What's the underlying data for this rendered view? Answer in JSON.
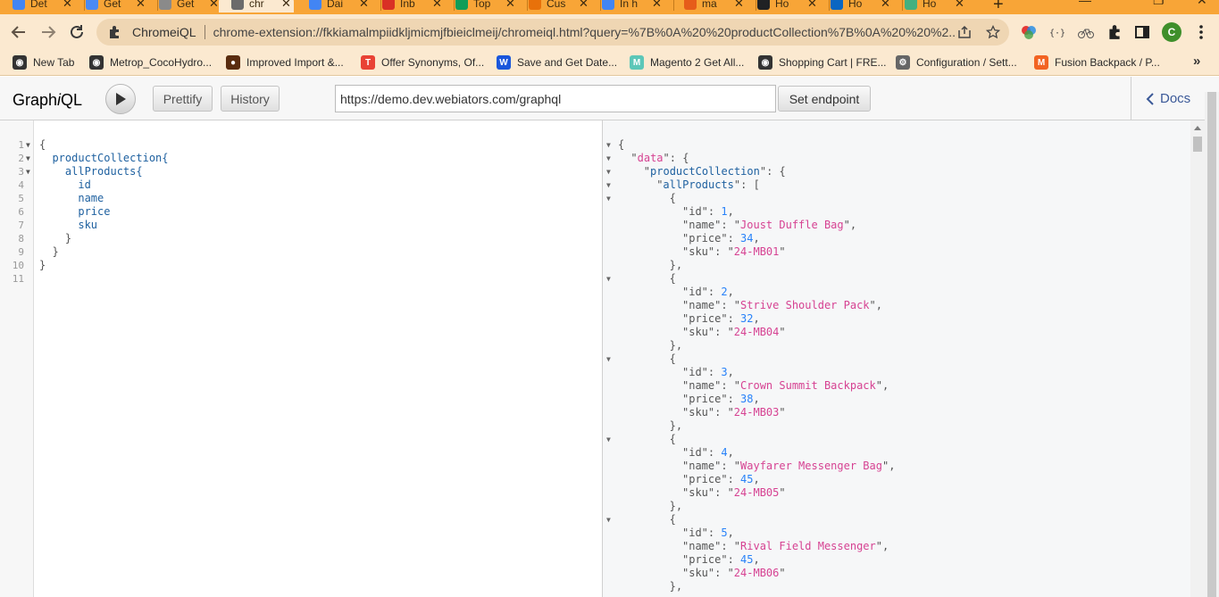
{
  "browser": {
    "tabs": [
      {
        "title": "Det",
        "color": "#4285f4"
      },
      {
        "title": "Get",
        "color": "#4a8af4"
      },
      {
        "title": "Get",
        "color": "#8a8a8a"
      },
      {
        "title": "chr",
        "color": "#6b6b6b"
      },
      {
        "title": "Dai",
        "color": "#4285f4"
      },
      {
        "title": "Inb",
        "color": "#d93025"
      },
      {
        "title": "Top",
        "color": "#0f9d58"
      },
      {
        "title": "Cus",
        "color": "#e8710a"
      },
      {
        "title": "In h",
        "color": "#4285f4"
      },
      {
        "title": "ma",
        "color": "#e65c1a"
      },
      {
        "title": "Ho",
        "color": "#202124"
      },
      {
        "title": "Ho",
        "color": "#0a66c2"
      },
      {
        "title": "Ho",
        "color": "#43b07f"
      }
    ],
    "site_label": "ChromeiQL",
    "url": "chrome-extension://fkkiamalmpiidkljmicmjfbieiclmeij/chromeiql.html?query=%7B%0A%20%20productCollection%7B%0A%20%20%2...",
    "avatar_letter": "C",
    "bookmarks": [
      {
        "label": "New Tab",
        "color": "#333333",
        "glyph": "◉"
      },
      {
        "label": "Metrop_CocoHydro...",
        "color": "#333333",
        "glyph": "◉"
      },
      {
        "label": "Improved Import &...",
        "color": "#5a2c0f",
        "glyph": "●"
      },
      {
        "label": "Offer Synonyms, Of...",
        "color": "#e94235",
        "glyph": "T"
      },
      {
        "label": "Save and Get Date...",
        "color": "#1a56db",
        "glyph": "W"
      },
      {
        "label": "Magento 2 Get All...",
        "color": "#5cc7b8",
        "glyph": "M"
      },
      {
        "label": "Shopping Cart | FRE...",
        "color": "#333333",
        "glyph": "◉"
      },
      {
        "label": "Configuration / Sett...",
        "color": "#666666",
        "glyph": "⚙"
      },
      {
        "label": "Fusion Backpack / P...",
        "color": "#f26322",
        "glyph": "M"
      }
    ]
  },
  "graphiql": {
    "logo_prefix": "Graph",
    "logo_italic": "i",
    "logo_suffix": "QL",
    "prettify_label": "Prettify",
    "history_label": "History",
    "endpoint_value": "https://demo.dev.webiators.com/graphql",
    "set_endpoint_label": "Set endpoint",
    "docs_label": "Docs"
  },
  "query_lines": [
    "{",
    "  productCollection{",
    "    allProducts{",
    "      id",
    "      name",
    "      price",
    "      sku",
    "    }",
    "  }",
    "}",
    ""
  ],
  "result": {
    "data_key": "data",
    "collection_key": "productCollection",
    "list_key": "allProducts",
    "products": [
      {
        "id": 1,
        "name": "Joust Duffle Bag",
        "price": 34,
        "sku": "24-MB01"
      },
      {
        "id": 2,
        "name": "Strive Shoulder Pack",
        "price": 32,
        "sku": "24-MB04"
      },
      {
        "id": 3,
        "name": "Crown Summit Backpack",
        "price": 38,
        "sku": "24-MB03"
      },
      {
        "id": 4,
        "name": "Wayfarer Messenger Bag",
        "price": 45,
        "sku": "24-MB05"
      },
      {
        "id": 5,
        "name": "Rival Field Messenger",
        "price": 45,
        "sku": "24-MB06"
      }
    ]
  }
}
